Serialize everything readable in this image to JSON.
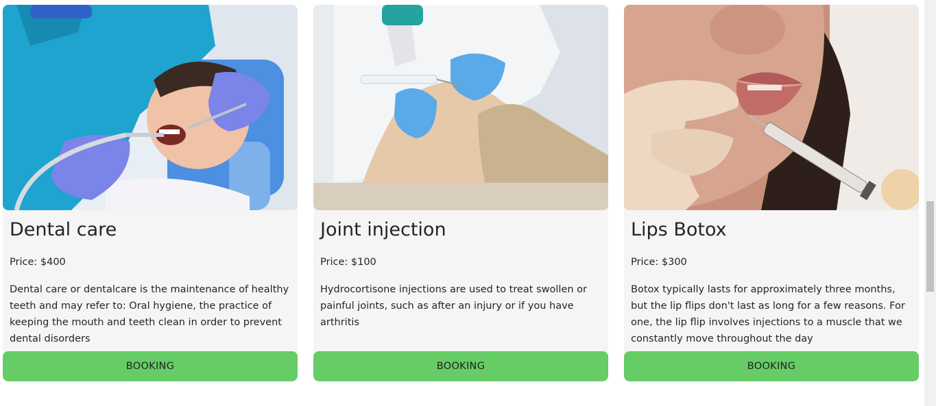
{
  "services": [
    {
      "title": "Dental care",
      "price": "Price: $400",
      "description": "Dental care or dentalcare is the maintenance of healthy teeth and may refer to: Oral hygiene, the practice of keeping the mouth and teeth clean in order to prevent dental disorders",
      "button_label": "BOOKING",
      "image": "dental-patient-photo"
    },
    {
      "title": "Joint injection",
      "price": "Price: $100",
      "description": "Hydrocortisone injections are used to treat swollen or painful joints, such as after an injury or if you have arthritis",
      "button_label": "BOOKING",
      "image": "knee-injection-photo"
    },
    {
      "title": "Lips Botox",
      "price": "Price: $300",
      "description": "Botox typically lasts for approximately three months, but the lip flips don't last as long for a few reasons. For one, the lip flip involves injections to a muscle that we constantly move throughout the day",
      "button_label": "BOOKING",
      "image": "lips-botox-photo"
    }
  ],
  "colors": {
    "card_background": "#f5f5f5",
    "booking_button": "#66cc66",
    "text": "#212529"
  }
}
